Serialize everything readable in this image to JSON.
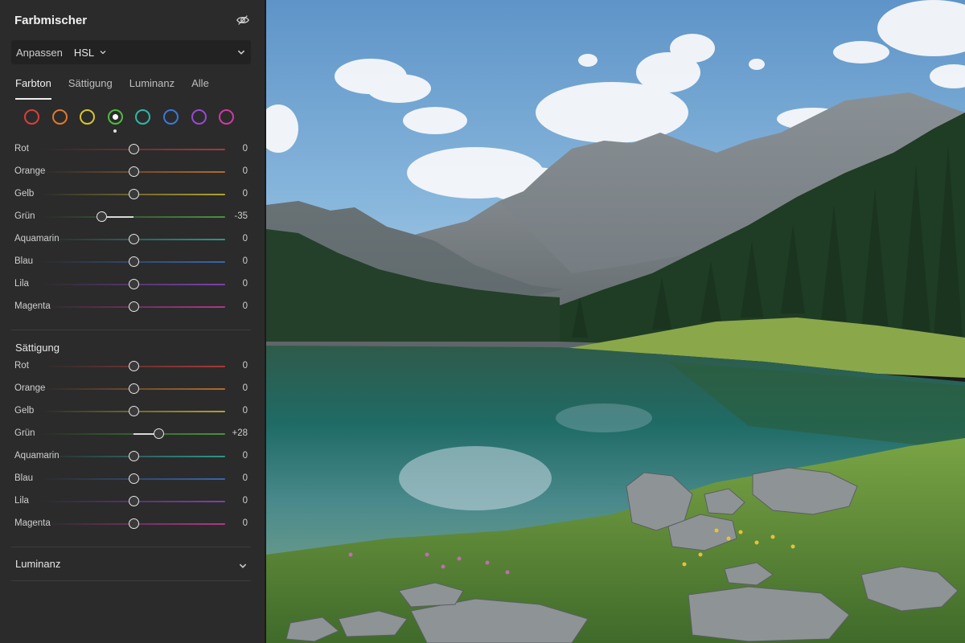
{
  "panel": {
    "title": "Farbmischer",
    "visibility_icon": "eye-slash-icon",
    "mode": {
      "label": "Anpassen",
      "value": "HSL"
    },
    "tabs": [
      {
        "label": "Farbton",
        "active": true
      },
      {
        "label": "Sättigung",
        "active": false
      },
      {
        "label": "Luminanz",
        "active": false
      },
      {
        "label": "Alle",
        "active": false
      }
    ],
    "swatches": [
      {
        "name": "red",
        "color": "#d8403a"
      },
      {
        "name": "orange",
        "color": "#e07a2a"
      },
      {
        "name": "yellow",
        "color": "#d6c431"
      },
      {
        "name": "green",
        "color": "#4fbb3d",
        "selected": true
      },
      {
        "name": "aqua",
        "color": "#2fb8a6"
      },
      {
        "name": "blue",
        "color": "#3a78d8"
      },
      {
        "name": "purple",
        "color": "#9a48d6"
      },
      {
        "name": "magenta",
        "color": "#cf3aa4"
      }
    ],
    "hue": {
      "rows": [
        {
          "label": "Rot",
          "value": 0,
          "display": "0"
        },
        {
          "label": "Orange",
          "value": 0,
          "display": "0"
        },
        {
          "label": "Gelb",
          "value": 0,
          "display": "0"
        },
        {
          "label": "Grün",
          "value": -35,
          "display": "-35"
        },
        {
          "label": "Aquamarin",
          "value": 0,
          "display": "0"
        },
        {
          "label": "Blau",
          "value": 0,
          "display": "0"
        },
        {
          "label": "Lila",
          "value": 0,
          "display": "0"
        },
        {
          "label": "Magenta",
          "value": 0,
          "display": "0"
        }
      ]
    },
    "saturation": {
      "title": "Sättigung",
      "rows": [
        {
          "label": "Rot",
          "value": 0,
          "display": "0"
        },
        {
          "label": "Orange",
          "value": 0,
          "display": "0"
        },
        {
          "label": "Gelb",
          "value": 0,
          "display": "0"
        },
        {
          "label": "Grün",
          "value": 28,
          "display": "+28"
        },
        {
          "label": "Aquamarin",
          "value": 0,
          "display": "0"
        },
        {
          "label": "Blau",
          "value": 0,
          "display": "0"
        },
        {
          "label": "Lila",
          "value": 0,
          "display": "0"
        },
        {
          "label": "Magenta",
          "value": 0,
          "display": "0"
        }
      ]
    },
    "luminance": {
      "title": "Luminanz",
      "collapsed": true
    }
  },
  "slider_range": [
    -100,
    100
  ],
  "track_colors": {
    "Rot": "#c23a3a",
    "Orange": "#c9772e",
    "Gelb": "#c9b832",
    "Grün": "#4aa83e",
    "Aquamarin": "#2ea89a",
    "Blau": "#3a6fc9",
    "Lila": "#8a45c4",
    "Magenta": "#c23b98"
  }
}
